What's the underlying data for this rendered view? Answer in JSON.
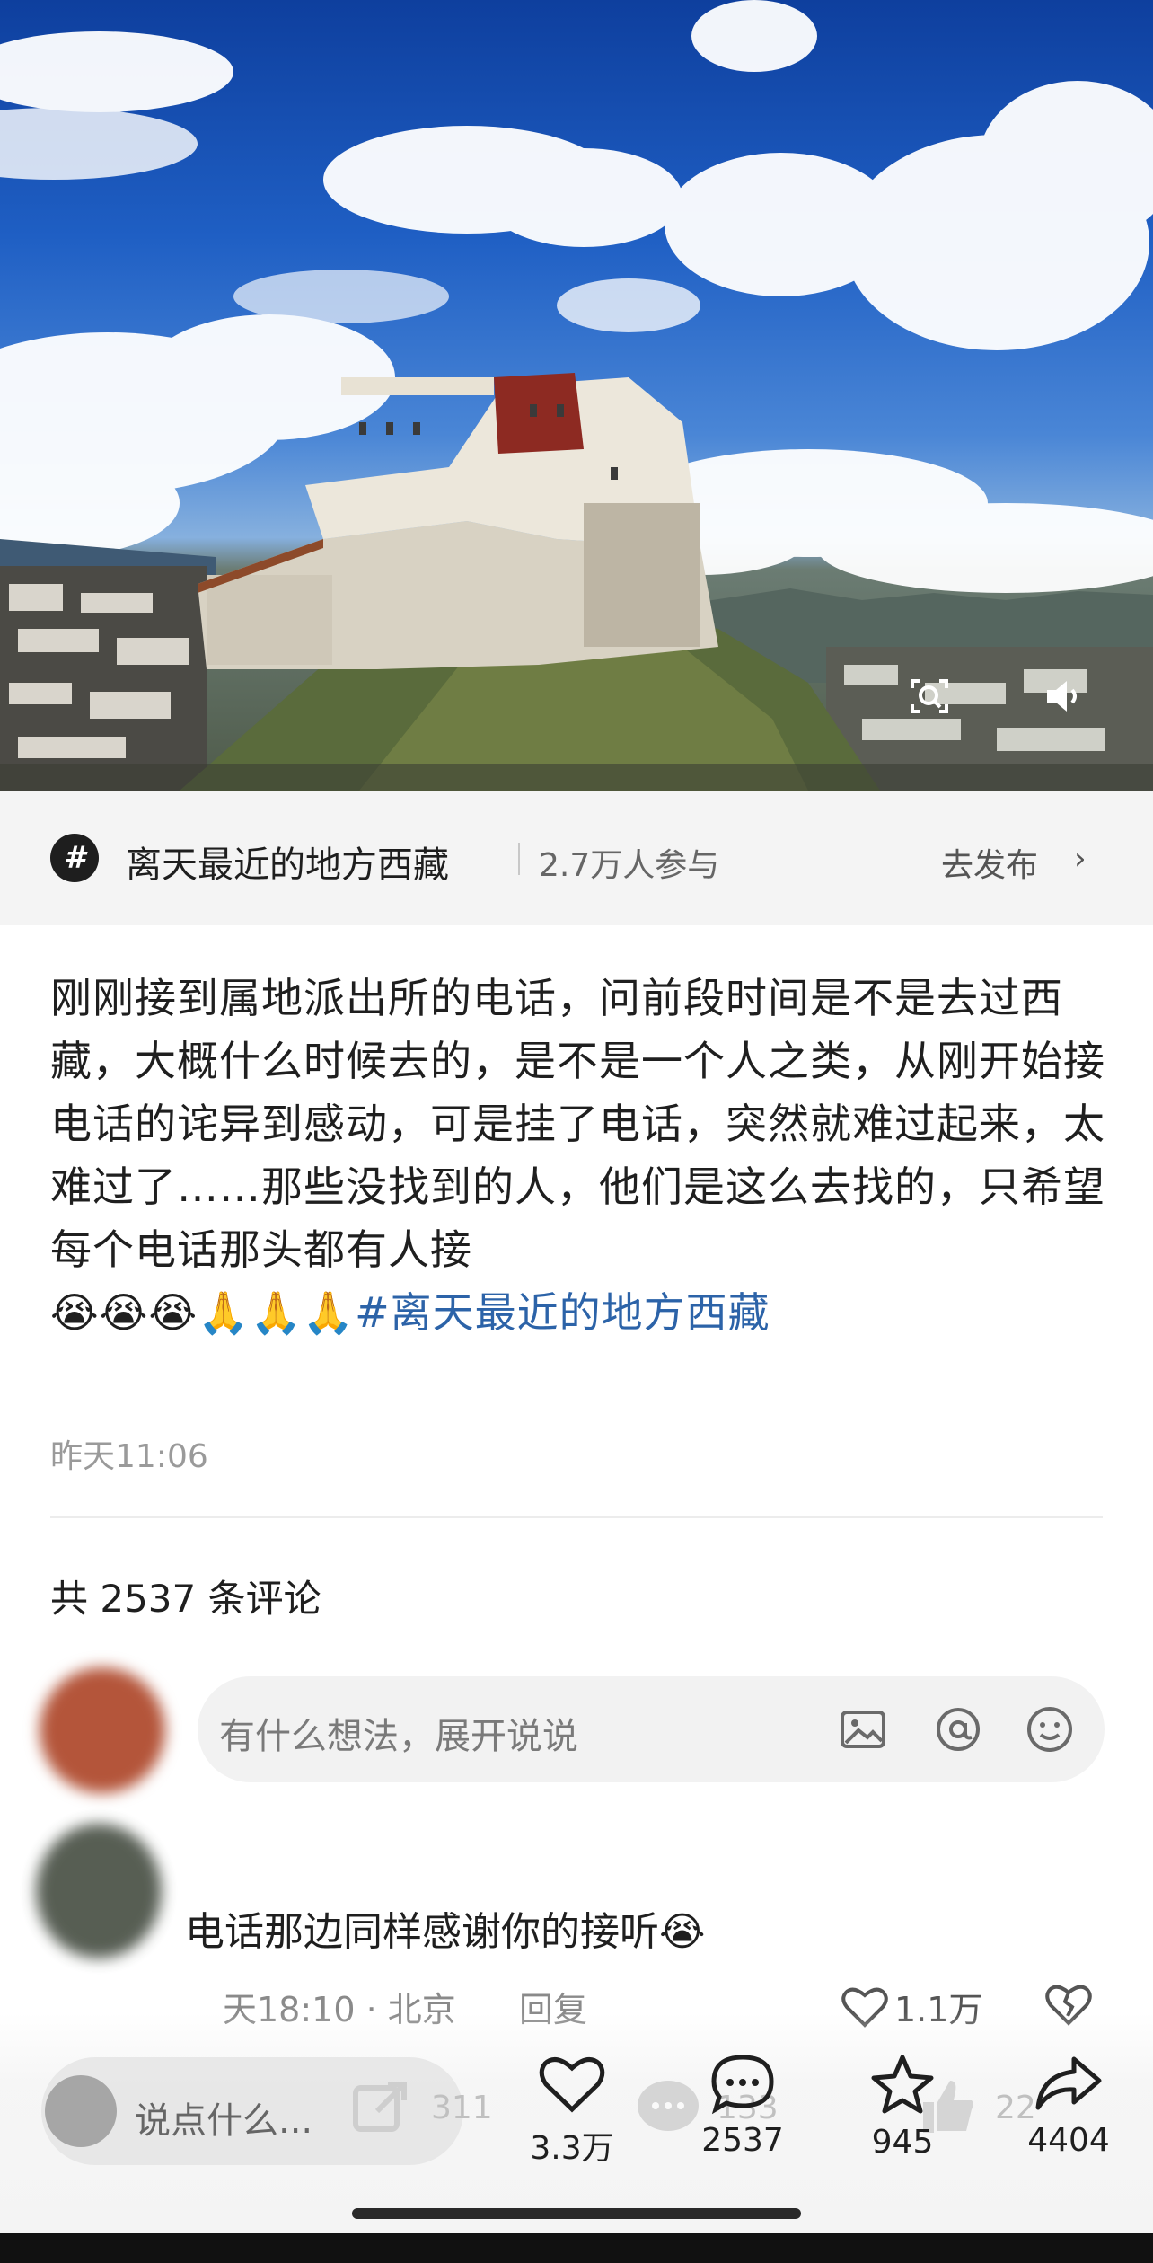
{
  "topic": {
    "icon": "hashtag-icon",
    "name": "离天最近的地方西藏",
    "participants": "2.7万人参与",
    "publish_label": "去发布",
    "chevron": "›"
  },
  "post": {
    "text": "刚刚接到属地派出所的电话，问前段时间是不是去过西藏，大概什么时候去的，是不是一个人之类，从刚开始接电话的诧异到感动，可是挂了电话，突然就难过起来，太难过了……那些没找到的人，他们是这么去找的，只希望每个电话那头都有人接",
    "emojis": "😭😭😭🙏🙏🙏",
    "hashtag": "#离天最近的地方西藏",
    "time": "昨天11:06"
  },
  "comments": {
    "count_label": "共 2537 条评论",
    "composer_placeholder": "有什么想法，展开说说",
    "items": [
      {
        "text": "电话那边同样感谢你的接听😭",
        "meta": "天18:10 · 北京",
        "reply_label": "回复",
        "likes": "1.1万"
      }
    ]
  },
  "bottom_bar": {
    "input_placeholder": "说点什么...",
    "likes": "3.3万",
    "comments": "2537",
    "stars": "945",
    "shares": "4404",
    "ghost_share": "311",
    "ghost_comment": "133",
    "ghost_like": "22"
  },
  "colors": {
    "hashtag": "#2c63a8",
    "topic_bar_bg": "#f4f4f4",
    "secondary_text": "#9a9a9a"
  }
}
